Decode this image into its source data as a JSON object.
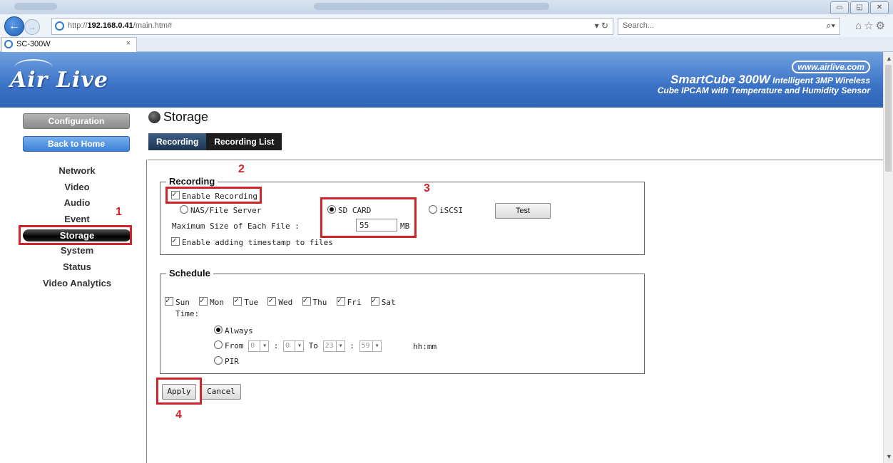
{
  "browser": {
    "url_prefix": "http://",
    "url_host": "192.168.0.41",
    "url_path": "/main.htm#",
    "search_placeholder": "Search...",
    "tab_title": "SC-300W",
    "tab_close": "×",
    "win_buttons": [
      "▭",
      "◱",
      "✕"
    ]
  },
  "banner": {
    "logo": "Air Live",
    "site": "www.airlive.com",
    "product_name": "SmartCube 300W",
    "product_line1": " Intelligent 3MP Wireless",
    "product_line2": "Cube IPCAM with Temperature and Humidity Sensor"
  },
  "sidebar": {
    "config_label": "Configuration",
    "home_label": "Back to Home",
    "items": [
      {
        "label": "Network"
      },
      {
        "label": "Video"
      },
      {
        "label": "Audio"
      },
      {
        "label": "Event"
      },
      {
        "label": "Storage",
        "active": true
      },
      {
        "label": "System"
      },
      {
        "label": "Status"
      },
      {
        "label": "Video Analytics"
      }
    ]
  },
  "page": {
    "title": "Storage",
    "tabs": [
      "Recording",
      "Recording List"
    ]
  },
  "recording": {
    "legend": "Recording",
    "enable_label": "Enable Recording",
    "nas_label": "NAS/File Server",
    "sd_label": "SD CARD",
    "iscsi_label": "iSCSI",
    "test_label": "Test",
    "max_size_label": "Maximum Size of Each File :",
    "max_size_value": "55",
    "max_size_unit": "MB",
    "timestamp_label": "Enable adding timestamp to files"
  },
  "schedule": {
    "legend": "Schedule",
    "days": [
      "Sun",
      "Mon",
      "Tue",
      "Wed",
      "Thu",
      "Fri",
      "Sat"
    ],
    "time_label": "Time:",
    "always_label": "Always",
    "from_label": "From",
    "to_label": "To",
    "from_h": "0",
    "from_m": "0",
    "to_h": "23",
    "to_m": "59",
    "colon": ":",
    "unit_label": "hh:mm",
    "pir_label": "PIR"
  },
  "actions": {
    "apply_label": "Apply",
    "cancel_label": "Cancel"
  },
  "annotations": {
    "n1": "1",
    "n2": "2",
    "n3": "3",
    "n4": "4",
    "color": "#d0232a"
  }
}
